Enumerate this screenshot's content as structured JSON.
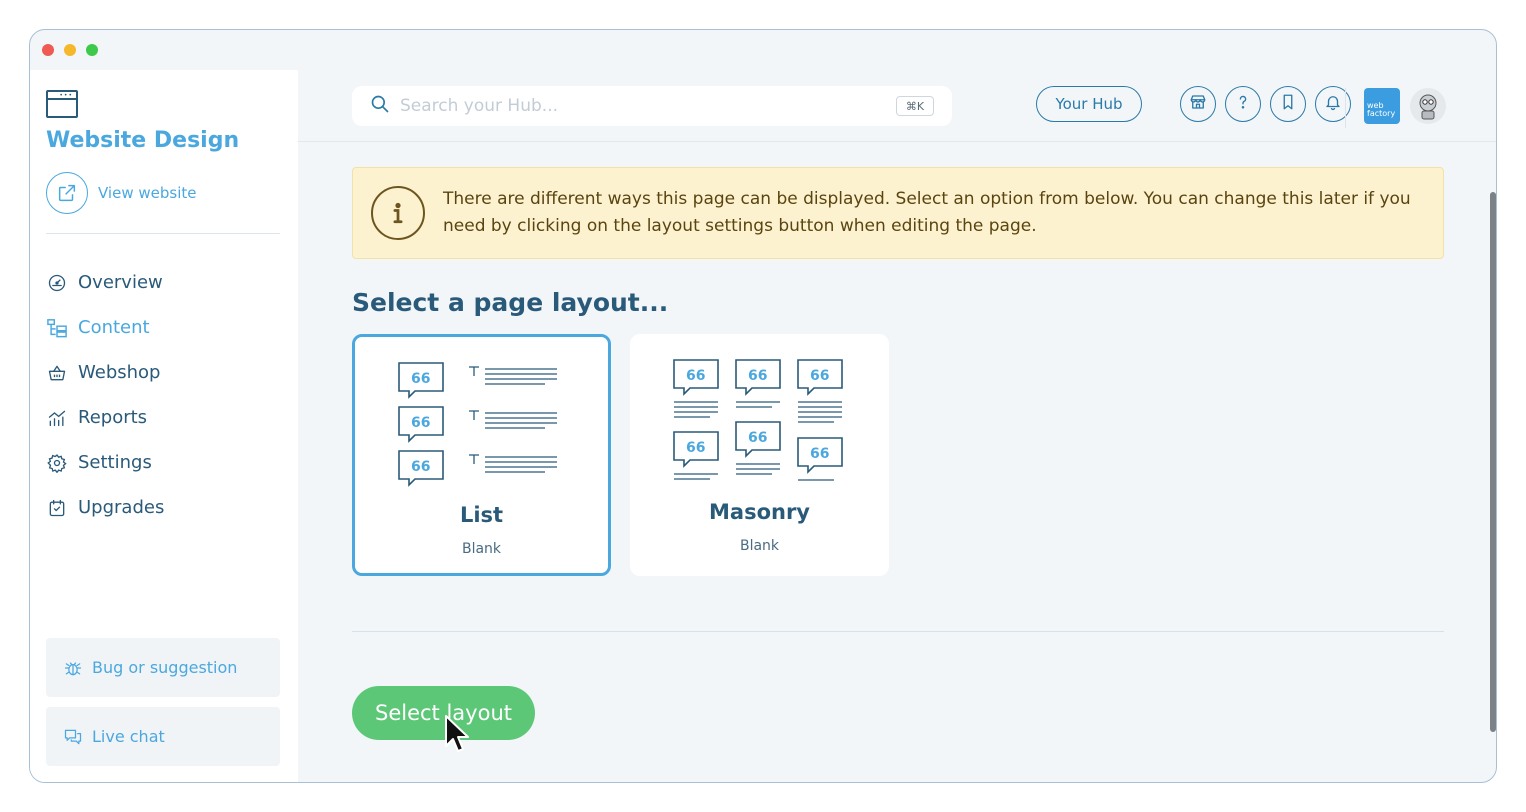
{
  "sidebar": {
    "title": "Website Design",
    "view_website": "View website",
    "nav": [
      {
        "label": "Overview",
        "icon": "gauge-icon"
      },
      {
        "label": "Content",
        "icon": "content-tree-icon",
        "active": true
      },
      {
        "label": "Webshop",
        "icon": "basket-icon"
      },
      {
        "label": "Reports",
        "icon": "chart-icon"
      },
      {
        "label": "Settings",
        "icon": "gear-icon"
      },
      {
        "label": "Upgrades",
        "icon": "calendar-check-icon"
      }
    ],
    "bug_label": "Bug or suggestion",
    "chat_label": "Live chat"
  },
  "topbar": {
    "search_placeholder": "Search your Hub...",
    "shortcut": "⌘K",
    "hub_label": "Your Hub",
    "logo_text": "web factory"
  },
  "main": {
    "info_text": "There are different ways this page can be displayed. Select an option from below. You can change this later if you need by clicking on the layout settings button when editing the page.",
    "section_title": "Select a page layout...",
    "layouts": [
      {
        "name": "List",
        "sub": "Blank",
        "selected": true
      },
      {
        "name": "Masonry",
        "sub": "Blank",
        "selected": false
      }
    ],
    "button_label": "Select layout"
  },
  "colors": {
    "accent": "#4aa8df",
    "navy": "#2a5a7a",
    "success": "#5cc877",
    "alert_bg": "#fdf2d0"
  }
}
